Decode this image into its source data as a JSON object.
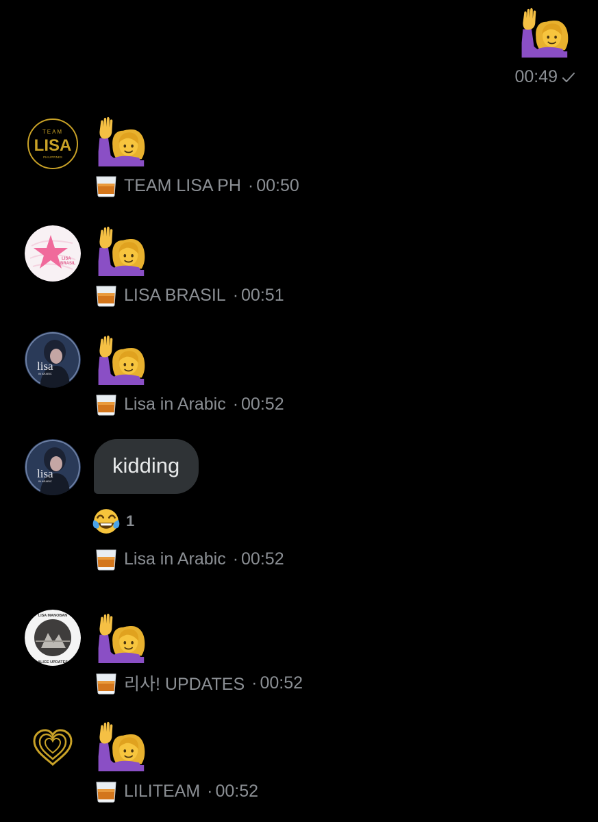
{
  "own_message": {
    "emoji": "raising-hand-woman",
    "time": "00:49",
    "status": "sent"
  },
  "messages": [
    {
      "sender": "TEAM LISA PH",
      "time": "00:50",
      "content_emoji": "raising-hand-woman",
      "avatar": {
        "line1": "TEAM",
        "line2": "LISA",
        "line3": "PHILIPPINES"
      }
    },
    {
      "sender": "LISA BRASIL",
      "time": "00:51",
      "content_emoji": "raising-hand-woman",
      "avatar": {
        "line1": "LISA",
        "line2": "BRASIL"
      }
    },
    {
      "sender": "Lisa in Arabic",
      "time": "00:52",
      "content_emoji": "raising-hand-woman",
      "avatar": {
        "line1": "lisa",
        "line2": "IN ARABIC"
      }
    },
    {
      "sender": "Lisa in Arabic",
      "time": "00:52",
      "text": "kidding",
      "reaction": {
        "emoji": "tears-of-joy",
        "count": "1"
      },
      "avatar": {
        "line1": "lisa",
        "line2": "IN ARABIC"
      }
    },
    {
      "sender": "리사! UPDATES",
      "time": "00:52",
      "content_emoji": "raising-hand-woman",
      "avatar": {
        "line1": "LISA MANOBAN",
        "line2": "ALICE UPDATES"
      }
    },
    {
      "sender": "LILITEAM",
      "time": "00:52",
      "content_emoji": "raising-hand-woman"
    }
  ],
  "separator": "·",
  "colors": {
    "background": "#000000",
    "meta_text": "#8b8f94",
    "bubble": "#2f3336",
    "bubble_text": "#e7e9ea",
    "gold": "#c9a227"
  }
}
